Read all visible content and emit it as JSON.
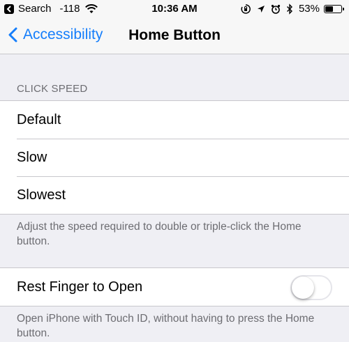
{
  "status_bar": {
    "back_app": "Search",
    "signal": "-118",
    "time": "10:36 AM",
    "battery": "53%",
    "battery_level": 0.53,
    "icons": [
      "wifi-icon",
      "orientation-lock-icon",
      "location-icon",
      "alarm-icon",
      "bluetooth-icon",
      "battery-icon"
    ]
  },
  "nav": {
    "back_label": "Accessibility",
    "title": "Home Button"
  },
  "click_speed": {
    "header": "CLICK SPEED",
    "options": [
      "Default",
      "Slow",
      "Slowest"
    ],
    "footer": "Adjust the speed required to double or triple-click the Home button."
  },
  "rest_finger": {
    "label": "Rest Finger to Open",
    "enabled": false,
    "footer": "Open iPhone with Touch ID, without having to press the Home button."
  },
  "colors": {
    "accent": "#157efb",
    "background": "#efeff4",
    "secondary_text": "#6d6d72"
  }
}
